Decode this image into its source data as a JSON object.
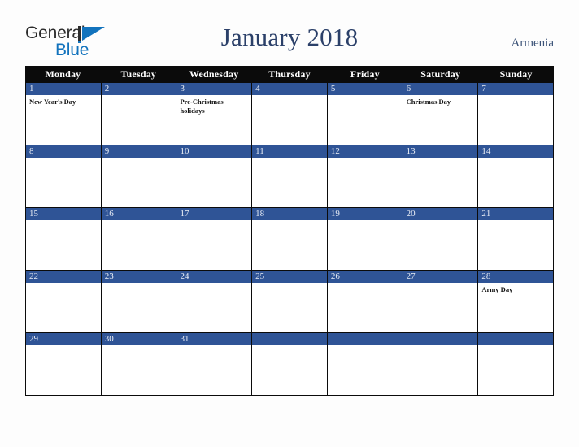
{
  "brand": {
    "word1": "General",
    "word2": "Blue",
    "mark_icon": "triangle-flag-icon",
    "color_primary": "#1273bd",
    "color_text": "#2b2b2b"
  },
  "header": {
    "title": "January 2018",
    "region": "Armenia",
    "title_color": "#2b4069"
  },
  "calendar": {
    "accent_color": "#2f5496",
    "header_bg": "#0b0b0b",
    "day_names": [
      "Monday",
      "Tuesday",
      "Wednesday",
      "Thursday",
      "Friday",
      "Saturday",
      "Sunday"
    ],
    "weeks": [
      [
        {
          "day": "1",
          "events": [
            "New Year's Day"
          ]
        },
        {
          "day": "2",
          "events": []
        },
        {
          "day": "3",
          "events": [
            "Pre-Christmas holidays"
          ]
        },
        {
          "day": "4",
          "events": []
        },
        {
          "day": "5",
          "events": []
        },
        {
          "day": "6",
          "events": [
            "Christmas Day"
          ]
        },
        {
          "day": "7",
          "events": []
        }
      ],
      [
        {
          "day": "8",
          "events": []
        },
        {
          "day": "9",
          "events": []
        },
        {
          "day": "10",
          "events": []
        },
        {
          "day": "11",
          "events": []
        },
        {
          "day": "12",
          "events": []
        },
        {
          "day": "13",
          "events": []
        },
        {
          "day": "14",
          "events": []
        }
      ],
      [
        {
          "day": "15",
          "events": []
        },
        {
          "day": "16",
          "events": []
        },
        {
          "day": "17",
          "events": []
        },
        {
          "day": "18",
          "events": []
        },
        {
          "day": "19",
          "events": []
        },
        {
          "day": "20",
          "events": []
        },
        {
          "day": "21",
          "events": []
        }
      ],
      [
        {
          "day": "22",
          "events": []
        },
        {
          "day": "23",
          "events": []
        },
        {
          "day": "24",
          "events": []
        },
        {
          "day": "25",
          "events": []
        },
        {
          "day": "26",
          "events": []
        },
        {
          "day": "27",
          "events": []
        },
        {
          "day": "28",
          "events": [
            "Army Day"
          ]
        }
      ],
      [
        {
          "day": "29",
          "events": []
        },
        {
          "day": "30",
          "events": []
        },
        {
          "day": "31",
          "events": []
        },
        {
          "day": "",
          "events": []
        },
        {
          "day": "",
          "events": []
        },
        {
          "day": "",
          "events": []
        },
        {
          "day": "",
          "events": []
        }
      ]
    ]
  }
}
